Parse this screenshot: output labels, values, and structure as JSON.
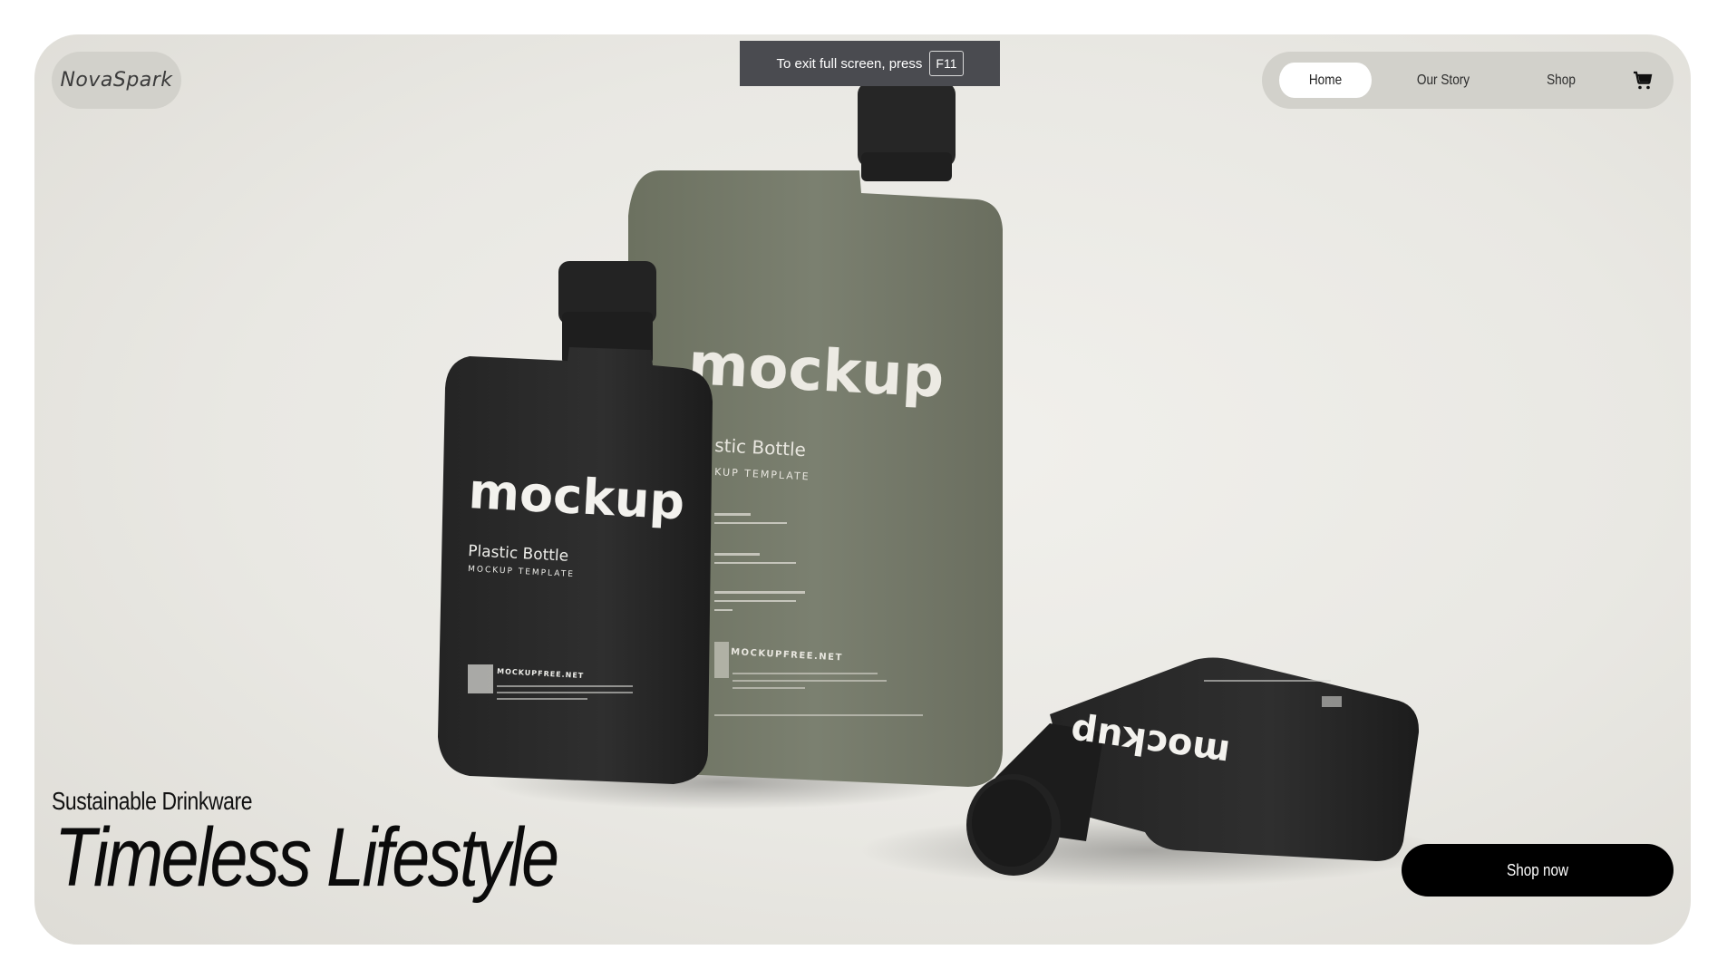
{
  "brand": {
    "logo_text": "NovaSpark"
  },
  "nav": {
    "items": [
      {
        "label": "Home",
        "active": true
      },
      {
        "label": "Our Story",
        "active": false
      },
      {
        "label": "Shop",
        "active": false
      }
    ],
    "cart_icon": "cart-icon"
  },
  "fullscreen_notice": {
    "text": "To exit full screen, press",
    "key": "F11"
  },
  "hero": {
    "subtitle": "Sustainable Drinkware",
    "headline": "Timeless Lifestyle",
    "cta_label": "Shop now"
  },
  "product_image": {
    "label_brand": "mockup",
    "label_title": "Plastic Bottle",
    "label_sub1": "MOCKUP",
    "label_sub2": "TEMPLATE",
    "label_site": "MOCKUPFREE.NET",
    "label_site_sub": "REALISTIC-MOCKUPS",
    "colors": {
      "olive": "#777c6b",
      "black": "#2a2a2a"
    }
  },
  "colors": {
    "background": "#ebeae6",
    "pill": "#d2d1cb",
    "active_nav": "#ffffff",
    "cta": "#000000",
    "toast": "#4a4b50"
  }
}
